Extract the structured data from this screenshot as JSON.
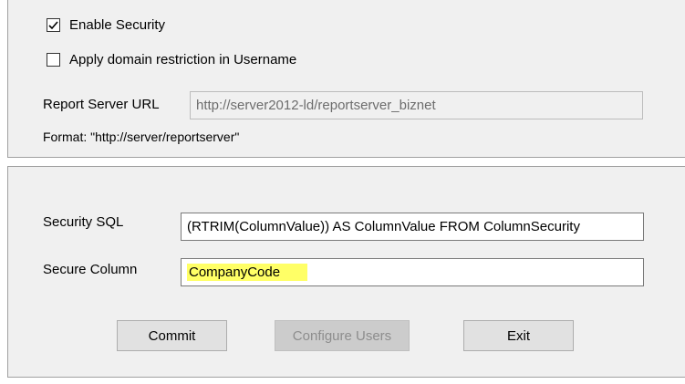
{
  "security": {
    "enable_label": "Enable Security",
    "enable_checked": true,
    "domain_label": "Apply domain restriction in Username",
    "domain_checked": false,
    "url_label": "Report Server URL",
    "url_value": "http://server2012-ld/reportserver_biznet",
    "format_hint": "Format: \"http://server/reportserver\""
  },
  "column_security": {
    "sql_label": "Security SQL",
    "sql_value": "(RTRIM(ColumnValue)) AS ColumnValue FROM ColumnSecurity",
    "column_label": "Secure Column",
    "column_value": "CompanyCode",
    "highlight_color": "#ffff66"
  },
  "buttons": {
    "commit": "Commit",
    "configure_users": "Configure Users",
    "exit": "Exit"
  }
}
